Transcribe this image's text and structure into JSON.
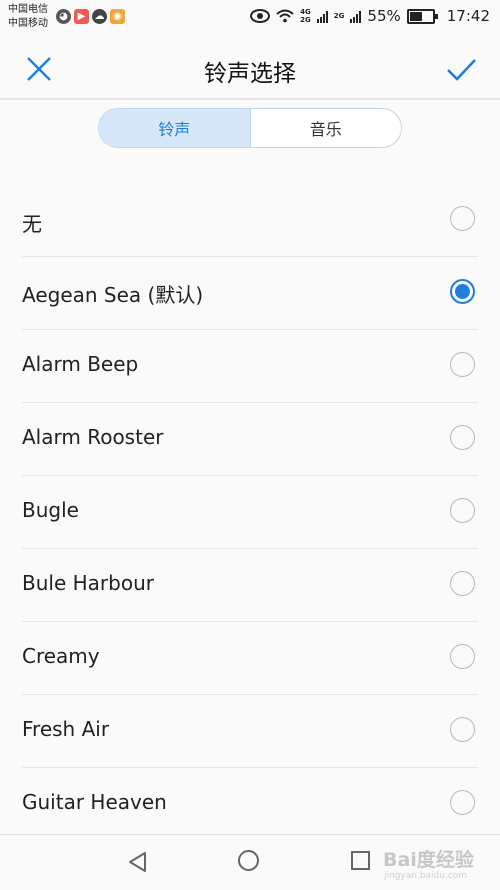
{
  "status_bar": {
    "carrier_1": "中国电信",
    "carrier_2": "中国移动",
    "battery_percent": "55%",
    "time": "17:42",
    "net_label_1": "4G",
    "net_label_2": "2G",
    "icons": [
      "wechat-icon",
      "video-app-icon",
      "cloud-icon",
      "weibo-icon",
      "eye-icon",
      "wifi-icon",
      "signal-icon",
      "battery-icon"
    ]
  },
  "header": {
    "title": "铃声选择"
  },
  "tabs": [
    {
      "label": "铃声",
      "active": true
    },
    {
      "label": "音乐",
      "active": false
    }
  ],
  "ringtones": [
    {
      "label": "无",
      "selected": false
    },
    {
      "label": "Aegean Sea (默认)",
      "selected": true
    },
    {
      "label": "Alarm Beep",
      "selected": false
    },
    {
      "label": "Alarm Rooster",
      "selected": false
    },
    {
      "label": "Bugle",
      "selected": false
    },
    {
      "label": "Bule Harbour",
      "selected": false
    },
    {
      "label": "Creamy",
      "selected": false
    },
    {
      "label": "Fresh Air",
      "selected": false
    },
    {
      "label": "Guitar Heaven",
      "selected": false
    }
  ],
  "watermark": {
    "text": "Bai度经验",
    "sub": "jingyan.baidu.com"
  },
  "colors": {
    "accent": "#1e7fe0",
    "tab_active_bg": "#d6e8f8"
  }
}
